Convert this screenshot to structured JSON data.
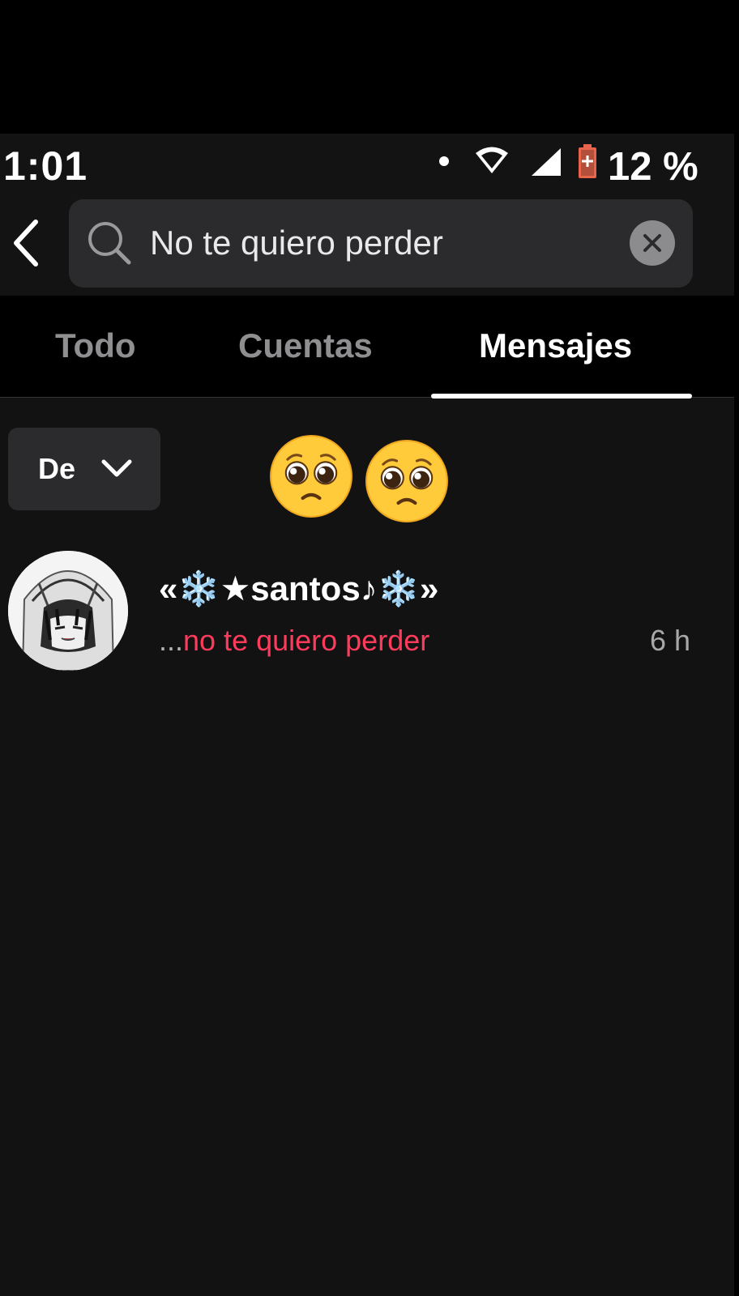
{
  "status_bar": {
    "time": "1:01",
    "battery": "12 %",
    "icons": [
      "dot-icon",
      "wifi-icon",
      "signal-icon",
      "battery-low-icon"
    ]
  },
  "search": {
    "value": "No te quiero perder",
    "icons": [
      "back-icon",
      "search-icon",
      "clear-icon"
    ]
  },
  "tabs": [
    {
      "label": "Todo",
      "active": false
    },
    {
      "label": "Cuentas",
      "active": false
    },
    {
      "label": "Mensajes",
      "active": true
    }
  ],
  "filter": {
    "label": "De",
    "icon": "chevron-down-icon"
  },
  "overlay": {
    "emoji": [
      "🥺",
      "🥺"
    ]
  },
  "results": [
    {
      "name": "«❄️★santos♪❄️»",
      "snippet_prefix": "...",
      "snippet_match": "no te quiero perder",
      "time": "6 h"
    }
  ],
  "colors": {
    "background": "#121213",
    "surface": "#2b2b2d",
    "highlight": "#ff3b5c",
    "text_primary": "#ffffff",
    "text_secondary": "#8f8f91"
  }
}
